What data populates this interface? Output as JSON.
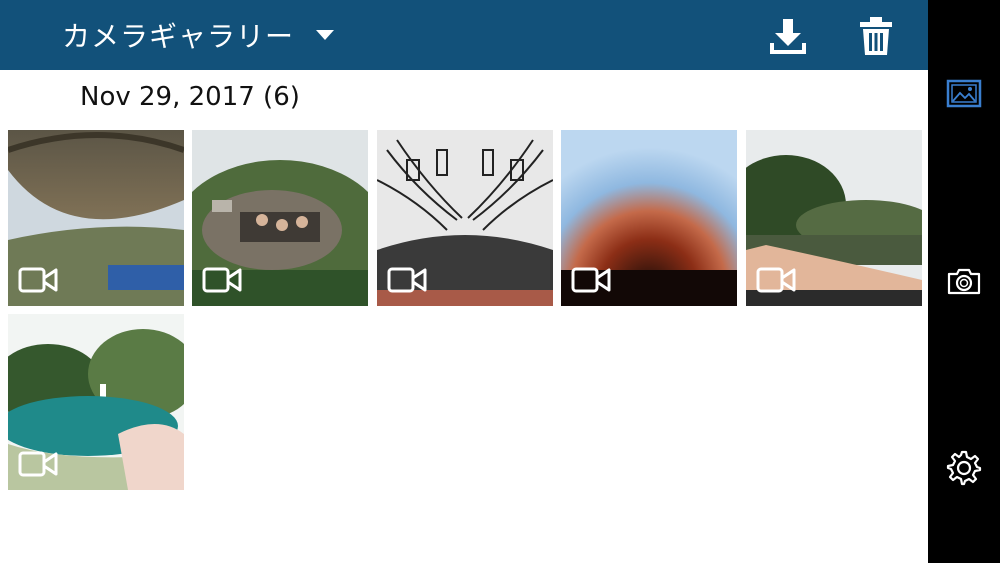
{
  "header": {
    "title": "カメラギャラリー",
    "dropdown_icon": "caret-down-icon",
    "download_icon": "download-icon",
    "delete_icon": "trash-icon",
    "bg_color": "#12517a"
  },
  "gallery": {
    "date_label": "Nov 29, 2017 (6)",
    "items": [
      {
        "type": "video",
        "icon": "video-camera-icon"
      },
      {
        "type": "video",
        "icon": "video-camera-icon"
      },
      {
        "type": "video",
        "icon": "video-camera-icon"
      },
      {
        "type": "video",
        "icon": "video-camera-icon"
      },
      {
        "type": "video",
        "icon": "video-camera-icon"
      },
      {
        "type": "video",
        "icon": "video-camera-icon"
      }
    ]
  },
  "side_rail": {
    "items": [
      {
        "name": "gallery",
        "icon": "image-gallery-icon",
        "active": true,
        "active_color": "#3a7fd0"
      },
      {
        "name": "camera",
        "icon": "camera-icon",
        "active": false
      },
      {
        "name": "settings",
        "icon": "gear-icon",
        "active": false
      }
    ]
  }
}
